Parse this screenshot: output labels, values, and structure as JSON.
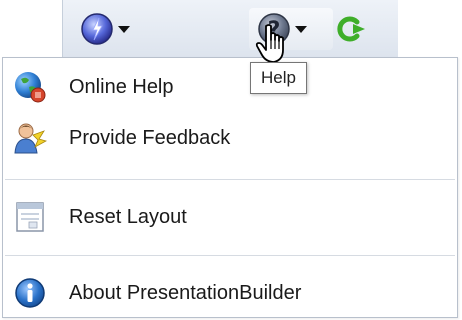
{
  "toolbar": {
    "buttons": [
      {
        "icon": "magic-wand-icon",
        "has_dropdown": true
      },
      {
        "icon": "help-icon",
        "has_dropdown": true,
        "tooltip": "Help"
      },
      {
        "icon": "refresh-arrow-icon",
        "has_dropdown": false
      }
    ]
  },
  "menu": {
    "items": [
      {
        "label": "Online Help",
        "icon": "globe-icon"
      },
      {
        "label": "Provide Feedback",
        "icon": "person-feedback-icon"
      },
      {
        "label": "Reset Layout",
        "icon": "layout-window-icon"
      },
      {
        "label": "About PresentationBuilder",
        "icon": "info-icon"
      }
    ]
  },
  "colors": {
    "toolbar_bg": "#e4e9f0",
    "menu_border": "#b8c0cc",
    "separator": "#d6dbe2",
    "text": "#1a1a1a",
    "refresh_green": "#3fae2a",
    "info_blue": "#2a72c9"
  }
}
